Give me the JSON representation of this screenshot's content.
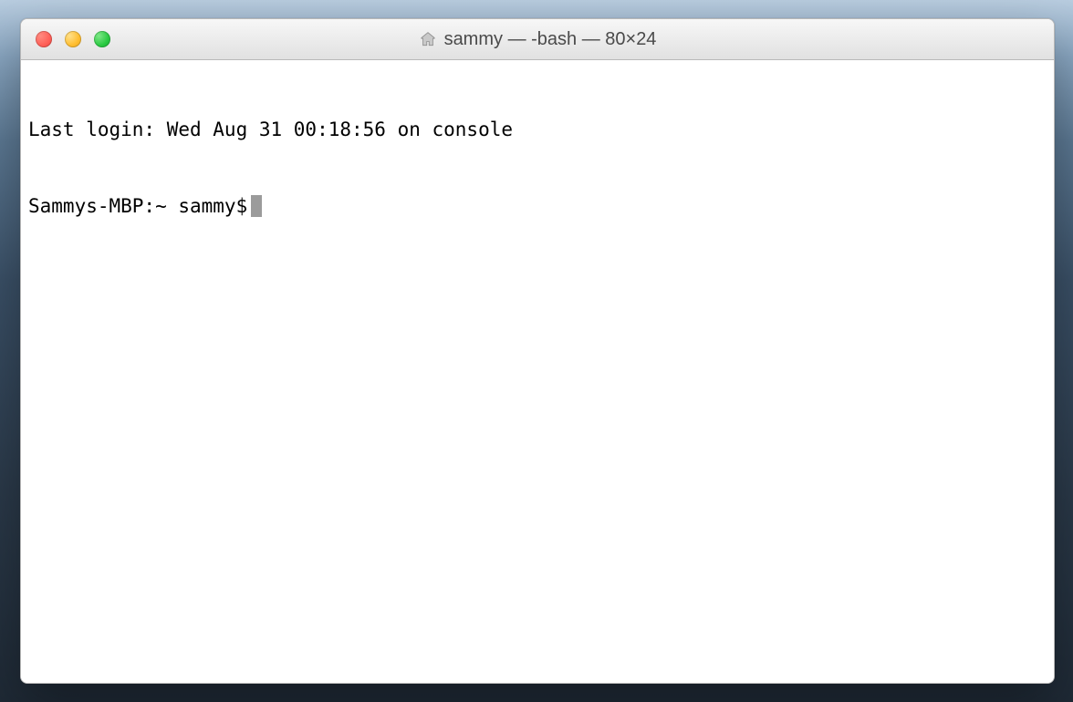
{
  "window": {
    "title": "sammy — -bash — 80×24"
  },
  "traffic_lights": {
    "close_color": "#ff5f57",
    "minimize_color": "#ffbd2e",
    "zoom_color": "#28c940"
  },
  "terminal": {
    "last_login_line": "Last login: Wed Aug 31 00:18:56 on console",
    "prompt": "Sammys-MBP:~ sammy$",
    "cursor_visible": true
  }
}
